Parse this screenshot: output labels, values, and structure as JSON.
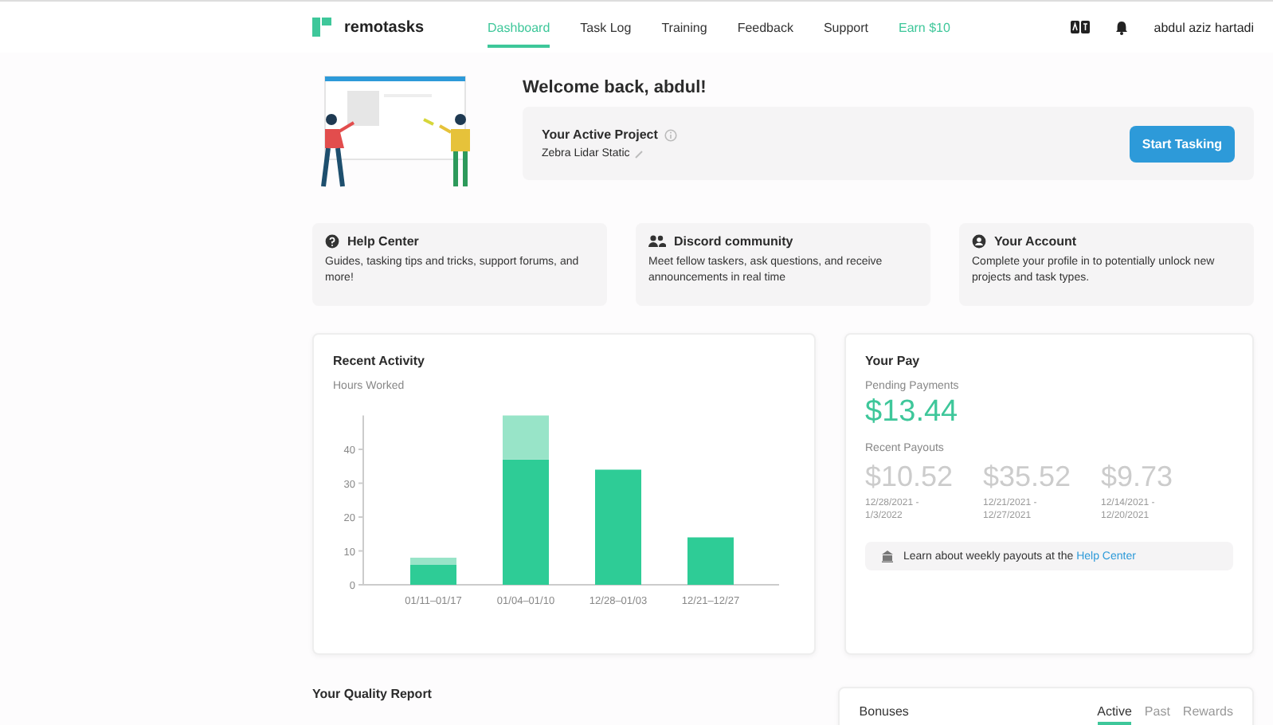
{
  "nav": {
    "brand": "remotasks",
    "links": [
      {
        "label": "Dashboard",
        "selected": true,
        "kind": "link"
      },
      {
        "label": "Task Log",
        "selected": false,
        "kind": "link"
      },
      {
        "label": "Training",
        "selected": false,
        "kind": "link"
      },
      {
        "label": "Feedback",
        "selected": false,
        "kind": "link"
      },
      {
        "label": "Support",
        "selected": false,
        "kind": "link"
      },
      {
        "label": "Earn $10",
        "selected": false,
        "kind": "promo"
      }
    ],
    "user": "abdul aziz hartadi"
  },
  "welcome": "Welcome back, abdul!",
  "active_project": {
    "title": "Your Active Project",
    "project": "Zebra Lidar Static",
    "button": "Start Tasking"
  },
  "cards": [
    {
      "kind": "help",
      "title": "Help Center",
      "text": "Guides, tasking tips and tricks, support forums, and more!"
    },
    {
      "kind": "community",
      "title": "Discord community",
      "text": "Meet fellow taskers, ask questions, and receive announcements in real time"
    },
    {
      "kind": "account",
      "title": "Your Account",
      "text": "Complete your profile in to potentially unlock new projects and task types."
    }
  ],
  "recent_activity": {
    "title": "Recent Activity",
    "chart_data": {
      "type": "bar",
      "ylabel": "Hours Worked",
      "categories": [
        "01/11–01/17",
        "01/04–01/10",
        "12/28–01/03",
        "12/21–12/27"
      ],
      "stacked": true,
      "ylim": [
        0,
        50
      ],
      "yticks": [
        0,
        10,
        20,
        30,
        40
      ],
      "series": [
        {
          "color": "#2ecc96",
          "values": [
            6,
            37,
            34,
            14
          ]
        },
        {
          "color": "#98e4c8",
          "values": [
            2,
            13,
            0,
            0
          ]
        }
      ]
    }
  },
  "pay": {
    "title": "Your Pay",
    "pending_label": "Pending Payments",
    "pending": "$13.44",
    "recent_label": "Recent Payouts",
    "payouts": [
      {
        "amount": "$10.52",
        "period": "12/28/2021 - 1/3/2022"
      },
      {
        "amount": "$35.52",
        "period": "12/21/2021 - 12/27/2021"
      },
      {
        "amount": "$9.73",
        "period": "12/14/2021 - 12/20/2021"
      }
    ],
    "info": {
      "text": "Learn about weekly payouts at the",
      "link": "Help Center"
    }
  },
  "quality": {
    "title": "Your Quality Report"
  },
  "bonuses": {
    "title": "Bonuses",
    "tabs": [
      {
        "label": "Active",
        "selected": true
      },
      {
        "label": "Past",
        "selected": false
      },
      {
        "label": "Rewards",
        "selected": false
      }
    ]
  }
}
